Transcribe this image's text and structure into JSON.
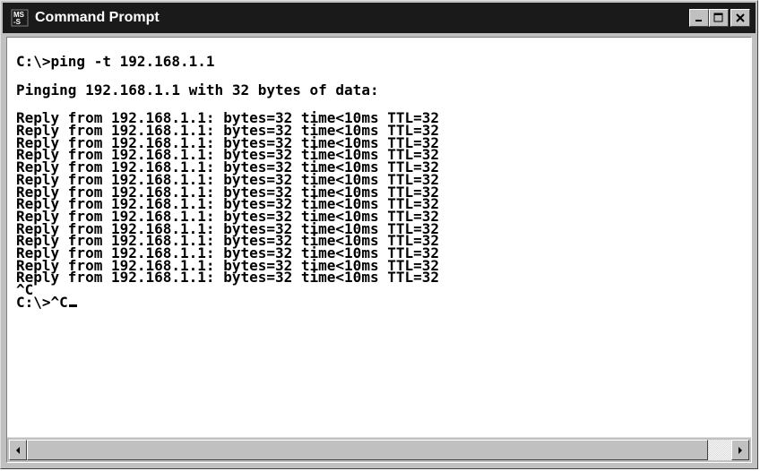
{
  "window": {
    "title": "Command Prompt",
    "titlebar_color": "#1a1a1a",
    "icon": "ms-dos-icon",
    "controls": [
      "minimize-icon",
      "maximize-icon",
      "close-icon"
    ]
  },
  "console": {
    "lines": [
      "C:\\>ping -t 192.168.1.1",
      "",
      "Pinging 192.168.1.1 with 32 bytes of data:",
      "",
      "Reply from 192.168.1.1: bytes=32 time<10ms TTL=32",
      "Reply from 192.168.1.1: bytes=32 time<10ms TTL=32",
      "Reply from 192.168.1.1: bytes=32 time<10ms TTL=32",
      "Reply from 192.168.1.1: bytes=32 time<10ms TTL=32",
      "Reply from 192.168.1.1: bytes=32 time<10ms TTL=32",
      "Reply from 192.168.1.1: bytes=32 time<10ms TTL=32",
      "Reply from 192.168.1.1: bytes=32 time<10ms TTL=32",
      "Reply from 192.168.1.1: bytes=32 time<10ms TTL=32",
      "Reply from 192.168.1.1: bytes=32 time<10ms TTL=32",
      "Reply from 192.168.1.1: bytes=32 time<10ms TTL=32",
      "Reply from 192.168.1.1: bytes=32 time<10ms TTL=32",
      "Reply from 192.168.1.1: bytes=32 time<10ms TTL=32",
      "Reply from 192.168.1.1: bytes=32 time<10ms TTL=32",
      "Reply from 192.168.1.1: bytes=32 time<10ms TTL=32",
      "^C",
      "C:\\>^C"
    ],
    "text_color": "#000000",
    "background_color": "#ffffff"
  },
  "scrollbar": {
    "left_arrow": "arrow-left-icon",
    "right_arrow": "arrow-right-icon"
  }
}
